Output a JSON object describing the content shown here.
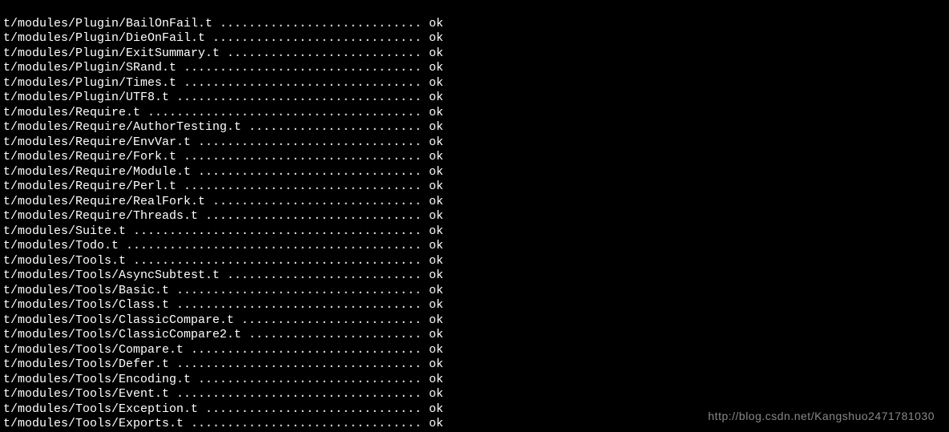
{
  "terminal": {
    "dot_column_target": 59,
    "lines": [
      {
        "path": "t/modules/Plugin/BailOnFail.t",
        "status": "ok"
      },
      {
        "path": "t/modules/Plugin/DieOnFail.t",
        "status": "ok"
      },
      {
        "path": "t/modules/Plugin/ExitSummary.t",
        "status": "ok"
      },
      {
        "path": "t/modules/Plugin/SRand.t",
        "status": "ok"
      },
      {
        "path": "t/modules/Plugin/Times.t",
        "status": "ok"
      },
      {
        "path": "t/modules/Plugin/UTF8.t",
        "status": "ok"
      },
      {
        "path": "t/modules/Require.t",
        "status": "ok"
      },
      {
        "path": "t/modules/Require/AuthorTesting.t",
        "status": "ok"
      },
      {
        "path": "t/modules/Require/EnvVar.t",
        "status": "ok"
      },
      {
        "path": "t/modules/Require/Fork.t",
        "status": "ok"
      },
      {
        "path": "t/modules/Require/Module.t",
        "status": "ok"
      },
      {
        "path": "t/modules/Require/Perl.t",
        "status": "ok"
      },
      {
        "path": "t/modules/Require/RealFork.t",
        "status": "ok"
      },
      {
        "path": "t/modules/Require/Threads.t",
        "status": "ok"
      },
      {
        "path": "t/modules/Suite.t",
        "status": "ok"
      },
      {
        "path": "t/modules/Todo.t",
        "status": "ok"
      },
      {
        "path": "t/modules/Tools.t",
        "status": "ok"
      },
      {
        "path": "t/modules/Tools/AsyncSubtest.t",
        "status": "ok"
      },
      {
        "path": "t/modules/Tools/Basic.t",
        "status": "ok"
      },
      {
        "path": "t/modules/Tools/Class.t",
        "status": "ok"
      },
      {
        "path": "t/modules/Tools/ClassicCompare.t",
        "status": "ok"
      },
      {
        "path": "t/modules/Tools/ClassicCompare2.t",
        "status": "ok"
      },
      {
        "path": "t/modules/Tools/Compare.t",
        "status": "ok"
      },
      {
        "path": "t/modules/Tools/Defer.t",
        "status": "ok"
      },
      {
        "path": "t/modules/Tools/Encoding.t",
        "status": "ok"
      },
      {
        "path": "t/modules/Tools/Event.t",
        "status": "ok"
      },
      {
        "path": "t/modules/Tools/Exception.t",
        "status": "ok"
      },
      {
        "path": "t/modules/Tools/Exports.t",
        "status": "ok"
      }
    ]
  },
  "watermark": "http://blog.csdn.net/Kangshuo2471781030"
}
